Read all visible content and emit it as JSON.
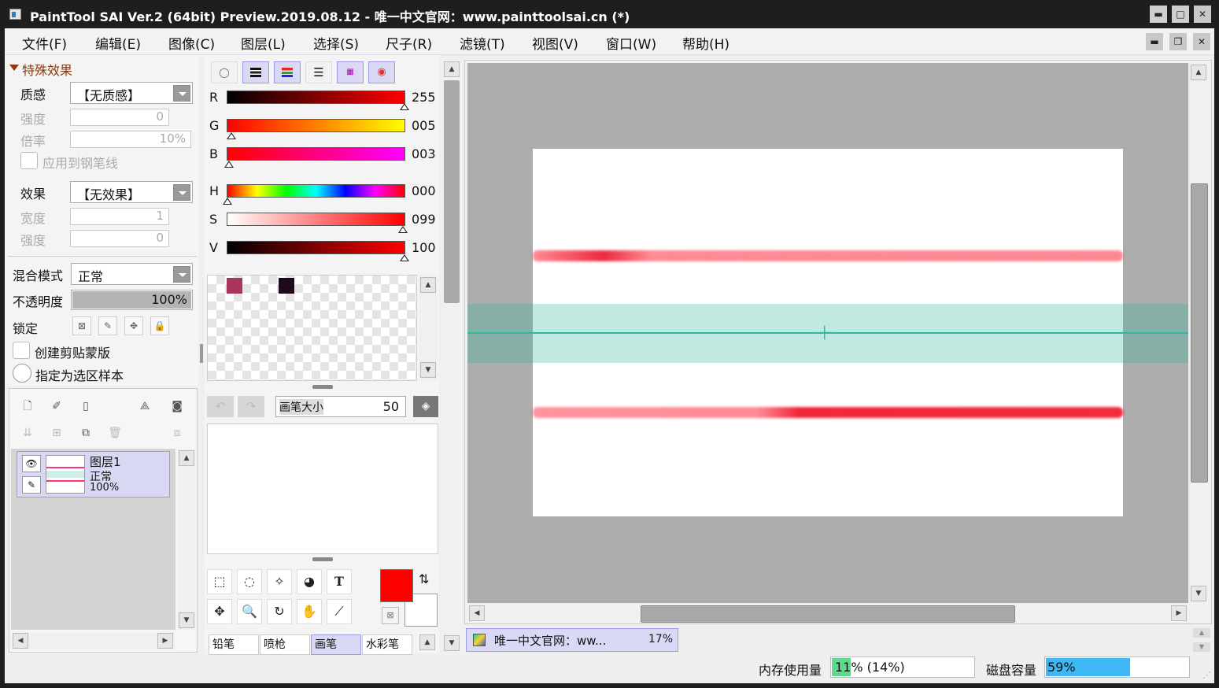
{
  "window": {
    "title": "PaintTool SAI Ver.2 (64bit) Preview.2019.08.12 - 唯一中文官网：www.painttoolsai.cn (*)",
    "min": "▬",
    "max": "□",
    "close": "✕",
    "mdi_min": "▬",
    "mdi_restore": "❐",
    "mdi_close": "✕"
  },
  "menu": [
    "文件(F)",
    "编辑(E)",
    "图像(C)",
    "图层(L)",
    "选择(S)",
    "尺子(R)",
    "滤镜(T)",
    "视图(V)",
    "窗口(W)",
    "帮助(H)"
  ],
  "effects": {
    "header": "特殊效果",
    "texture_label": "质感",
    "texture_value": "【无质感】",
    "strength_label": "强度",
    "strength_value": "0",
    "scale_label": "倍率",
    "scale_value": "10%",
    "apply_pen": "应用到钢笔线",
    "effect_label": "效果",
    "effect_value": "【无效果】",
    "width_label": "宽度",
    "width_value": "1",
    "strength2_label": "强度",
    "strength2_value": "0"
  },
  "layer_props": {
    "blend_label": "混合模式",
    "blend_value": "正常",
    "opacity_label": "不透明度",
    "opacity_value": "100%",
    "opacity_fill": 1.0,
    "lock_label": "锁定",
    "clip_label": "创建剪贴蒙版",
    "sample_label": "指定为选区样本"
  },
  "layers": [
    {
      "name": "图层1",
      "mode": "正常",
      "opacity": "100%"
    }
  ],
  "color": {
    "R": {
      "label": "R",
      "value": "255",
      "pos": 1.0
    },
    "G": {
      "label": "G",
      "value": "005",
      "pos": 0.02
    },
    "B": {
      "label": "B",
      "value": "003",
      "pos": 0.01
    },
    "H": {
      "label": "H",
      "value": "000",
      "pos": 0.0
    },
    "S": {
      "label": "S",
      "value": "099",
      "pos": 0.99
    },
    "V": {
      "label": "V",
      "value": "100",
      "pos": 1.0
    },
    "primary": "#ff0000",
    "secondary": "#ffffff"
  },
  "swatches": [
    "#a8355a",
    "#1f0a1c"
  ],
  "brush": {
    "size_label": "画笔大小",
    "size_value": "50"
  },
  "tool_tabs": [
    "铅笔",
    "喷枪",
    "画笔",
    "水彩笔"
  ],
  "canvas": {
    "bg": "#ffffff",
    "guide_color": "#2fb89a",
    "cursor": "+"
  },
  "doc_tab": {
    "name": "唯一中文官网：ww...",
    "zoom": "17%"
  },
  "status": {
    "mem_label": "内存使用量",
    "mem_value": "11% (14%)",
    "mem_fill": 0.11,
    "disk_label": "磁盘容量",
    "disk_value": "59%",
    "disk_fill": 0.59
  }
}
